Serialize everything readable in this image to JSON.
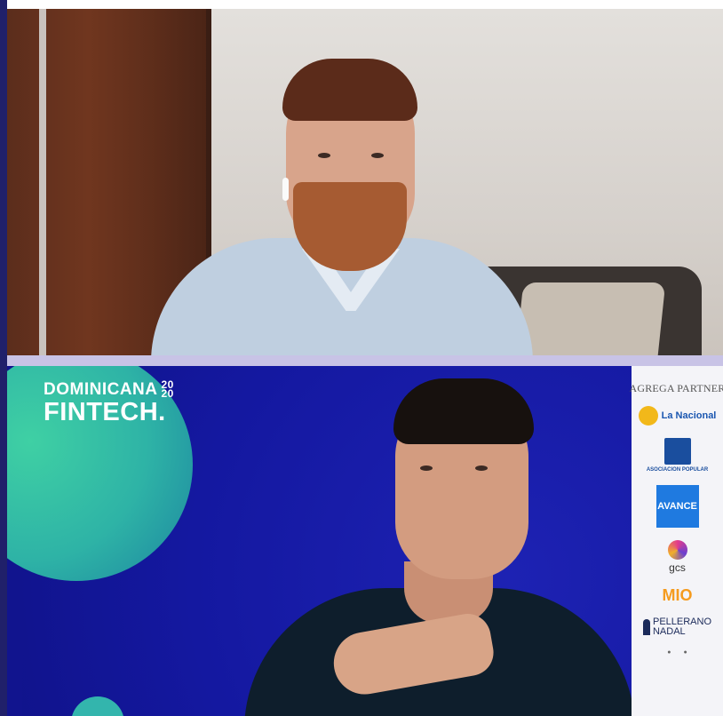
{
  "brand": {
    "line1": "DOMINICANA",
    "year_top": "20",
    "year_bottom": "20",
    "line2": "FINTECH."
  },
  "sponsors": {
    "heading": "AGREGA PARTNER",
    "items": [
      "La Nacional",
      "ASOCIACION POPULAR",
      "AVANCE",
      "gcs",
      "MIO",
      "PELLERANO",
      "NADAL"
    ]
  }
}
